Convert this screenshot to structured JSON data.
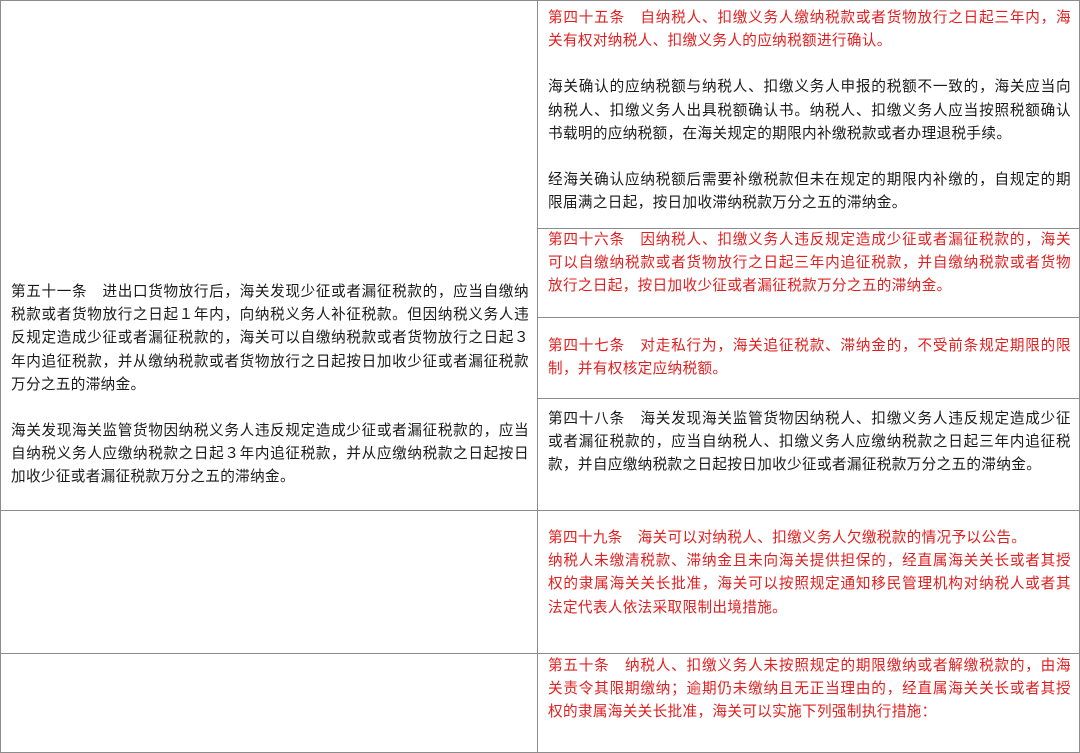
{
  "table": {
    "left": {
      "art51_line1": "第五十一条　进出口货物放行后，海关发现少征或者漏征税款的，应当自缴纳税款或者货物放行之日起１年内，向纳税义务人补征税款。但因纳税义务人违反规定造成少征或者漏征税款的，海关可以自缴纳税款或者货物放行之日起３年内追征税款，并从缴纳税款或者货物放行之日起按日加收少征或者漏征税款万分之五的滞纳金。",
      "art51_line2": "海关发现海关监管货物因纳税义务人违反规定造成少征或者漏征税款的，应当自纳税义务人应缴纳税款之日起３年内追征税款，并从应缴纳税款之日起按日加收少征或者漏征税款万分之五的滞纳金。"
    },
    "right": {
      "art45_p1": "第四十五条　自纳税人、扣缴义务人缴纳税款或者货物放行之日起三年内，海关有权对纳税人、扣缴义务人的应纳税额进行确认。",
      "art45_p2": "海关确认的应纳税额与纳税人、扣缴义务人申报的税额不一致的，海关应当向纳税人、扣缴义务人出具税额确认书。纳税人、扣缴义务人应当按照税额确认书载明的应纳税额，在海关规定的期限内补缴税款或者办理退税手续。",
      "art45_p3": "经海关确认应纳税额后需要补缴税款但未在规定的期限内补缴的，自规定的期限届满之日起，按日加收滞纳税款万分之五的滞纳金。",
      "art46": "第四十六条　因纳税人、扣缴义务人违反规定造成少征或者漏征税款的，海关可以自缴纳税款或者货物放行之日起三年内追征税款，并自缴纳税款或者货物放行之日起，按日加收少征或者漏征税款万分之五的滞纳金。",
      "art47": "第四十七条　对走私行为，海关追征税款、滞纳金的，不受前条规定期限的限制，并有权核定应纳税额。",
      "art48": "第四十八条　海关发现海关监管货物因纳税人、扣缴义务人违反规定造成少征或者漏征税款的，应当自纳税人、扣缴义务人应缴纳税款之日起三年内追征税款，并自应缴纳税款之日起按日加收少征或者漏征税款万分之五的滞纳金。",
      "art49_p1": "第四十九条　海关可以对纳税人、扣缴义务人欠缴税款的情况予以公告。",
      "art49_p2": "纳税人未缴清税款、滞纳金且未向海关提供担保的，经直属海关关长或者其授权的隶属海关关长批准，海关可以按照规定通知移民管理机构对纳税人或者其法定代表人依法采取限制出境措施。",
      "art50": "第五十条　纳税人、扣缴义务人未按照规定的期限缴纳或者解缴税款的，由海关责令其限期缴纳；逾期仍未缴纳且无正当理由的，经直属海关关长或者其授权的隶属海关关长批准，海关可以实施下列强制执行措施："
    }
  }
}
